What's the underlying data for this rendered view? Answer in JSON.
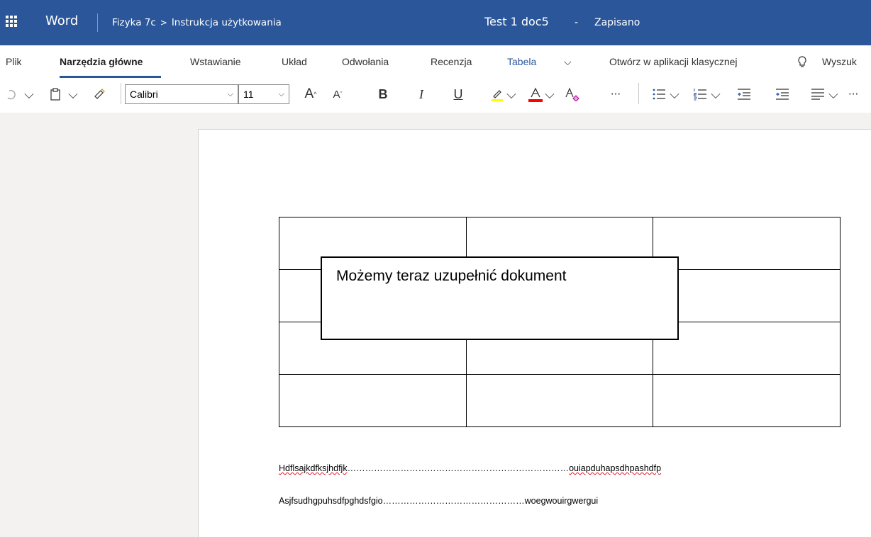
{
  "titlebar": {
    "app_name": "Word",
    "breadcrumb_folder": "Fizyka 7c",
    "breadcrumb_chevron": ">",
    "breadcrumb_file": "Instrukcja użytkowania",
    "doc_title": "Test 1 doc5",
    "dash": "-",
    "saved_status": "Zapisano"
  },
  "ribbon": {
    "tabs": {
      "plik": "Plik",
      "home": "Narzędzia główne",
      "insert": "Wstawianie",
      "layout": "Układ",
      "references": "Odwołania",
      "review": "Recenzja",
      "table": "Tabela",
      "more": "⌵",
      "open_desktop": "Otwórz w aplikacji klasycznej",
      "search": "Wyszuk"
    },
    "toolbar": {
      "font_name": "Calibri",
      "font_size": "11",
      "chevron": "⌵",
      "grow_font": "A",
      "shrink_font": "A",
      "bold": "B",
      "italic": "I",
      "underline": "U",
      "more": "···"
    },
    "colors": {
      "highlight": "#ffff00",
      "font_color": "#ff0000",
      "accent": "#2b579a"
    }
  },
  "document": {
    "callout_text": "Możemy teraz uzupełnić dokument",
    "line1_part1": "Hdflsajkdfksjhdfjk",
    "line1_dots": "…………………………………………………………………",
    "line1_part2": "ouiapduhapsdhpashdfp",
    "line2": "Asjfsudhgpuhsdfpghdsfgio…………………………………………woegwouirgwergui"
  }
}
